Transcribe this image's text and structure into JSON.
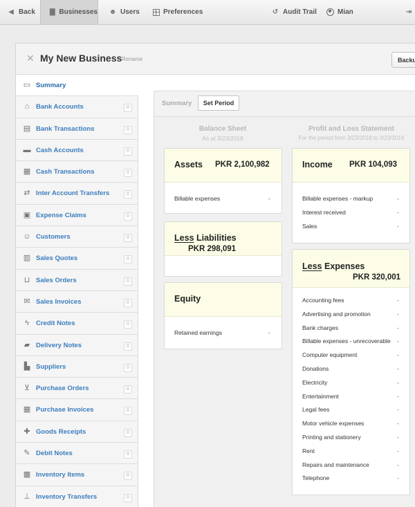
{
  "nav": {
    "back": "Back",
    "businesses": "Businesses",
    "users": "Users",
    "preferences": "Preferences",
    "audit_trail": "Audit Trail",
    "user_name": "Mian"
  },
  "header": {
    "title": "My New Business",
    "rename": "Rename",
    "backup": "Backu"
  },
  "sidebar": {
    "items": [
      {
        "label": "Summary",
        "icon": "monitor-icon",
        "count": ""
      },
      {
        "label": "Bank Accounts",
        "icon": "bank-icon",
        "count": "0"
      },
      {
        "label": "Bank Transactions",
        "icon": "bank-transaction-icon",
        "count": "0"
      },
      {
        "label": "Cash Accounts",
        "icon": "cash-icon",
        "count": "0"
      },
      {
        "label": "Cash Transactions",
        "icon": "cash-transaction-icon",
        "count": "0"
      },
      {
        "label": "Inter Account Transfers",
        "icon": "transfer-icon",
        "count": "0"
      },
      {
        "label": "Expense Claims",
        "icon": "expense-icon",
        "count": "0"
      },
      {
        "label": "Customers",
        "icon": "customers-icon",
        "count": "0"
      },
      {
        "label": "Sales Quotes",
        "icon": "quote-icon",
        "count": "0"
      },
      {
        "label": "Sales Orders",
        "icon": "basket-icon",
        "count": "0"
      },
      {
        "label": "Sales Invoices",
        "icon": "invoice-icon",
        "count": "0"
      },
      {
        "label": "Credit Notes",
        "icon": "lightning-icon",
        "count": "0"
      },
      {
        "label": "Delivery Notes",
        "icon": "truck-icon",
        "count": "0"
      },
      {
        "label": "Suppliers",
        "icon": "building-icon",
        "count": "0"
      },
      {
        "label": "Purchase Orders",
        "icon": "cart-icon",
        "count": "0"
      },
      {
        "label": "Purchase Invoices",
        "icon": "calendar-icon",
        "count": "0"
      },
      {
        "label": "Goods Receipts",
        "icon": "puzzle-icon",
        "count": "0"
      },
      {
        "label": "Debit Notes",
        "icon": "debit-note-icon",
        "count": "0"
      },
      {
        "label": "Inventory Items",
        "icon": "box-icon",
        "count": "0"
      },
      {
        "label": "Inventory Transfers",
        "icon": "forklift-icon",
        "count": "0"
      }
    ]
  },
  "toolbar": {
    "summary": "Summary",
    "set_period": "Set Period"
  },
  "balance_sheet": {
    "title": "Balance Sheet",
    "subtitle": "As at 3/23/2018",
    "assets": {
      "title": "Assets",
      "amount": "PKR 2,100,982",
      "lines": [
        {
          "label": "Billable expenses",
          "value": "-"
        }
      ]
    },
    "liabilities": {
      "less": "Less",
      "title": "Liabilities",
      "amount": "PKR 298,091"
    },
    "equity": {
      "title": "Equity",
      "lines": [
        {
          "label": "Retained earnings",
          "value": "-"
        }
      ]
    }
  },
  "profit_loss": {
    "title": "Profit and Loss Statement",
    "subtitle": "For the period from 3/23/2018 to 3/23/2018",
    "income": {
      "title": "Income",
      "amount": "PKR 104,093",
      "lines": [
        {
          "label": "Billable expenses - markup",
          "value": "-"
        },
        {
          "label": "Interest received",
          "value": "-"
        },
        {
          "label": "Sales",
          "value": "-"
        }
      ]
    },
    "expenses": {
      "less": "Less",
      "title": "Expenses",
      "amount": "PKR 320,001",
      "lines": [
        {
          "label": "Accounting fees",
          "value": "-"
        },
        {
          "label": "Advertising and promotion",
          "value": "-"
        },
        {
          "label": "Bank charges",
          "value": "-"
        },
        {
          "label": "Billable expenses - unrecoverable",
          "value": "-"
        },
        {
          "label": "Computer equipment",
          "value": "-"
        },
        {
          "label": "Donations",
          "value": "-"
        },
        {
          "label": "Electricity",
          "value": "-"
        },
        {
          "label": "Entertainment",
          "value": "-"
        },
        {
          "label": "Legal fees",
          "value": "-"
        },
        {
          "label": "Motor vehicle expenses",
          "value": "-"
        },
        {
          "label": "Printing and stationery",
          "value": "-"
        },
        {
          "label": "Rent",
          "value": "-"
        },
        {
          "label": "Repairs and maintenance",
          "value": "-"
        },
        {
          "label": "Telephone",
          "value": "-"
        }
      ]
    }
  },
  "colors": {
    "link": "#3b7dbd",
    "card_head": "#fdfde7"
  }
}
